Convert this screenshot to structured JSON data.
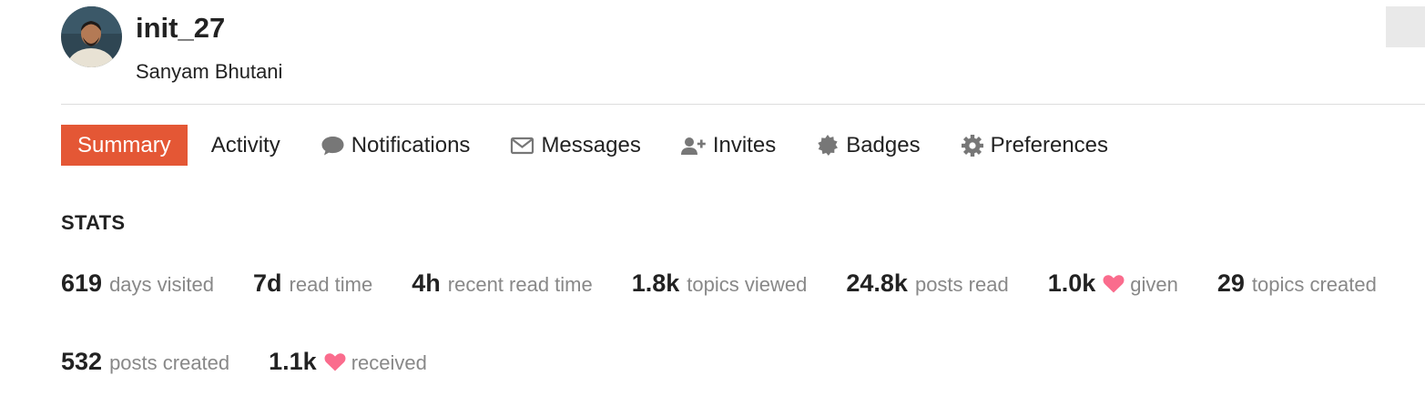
{
  "profile": {
    "username": "init_27",
    "full_name": "Sanyam Bhutani",
    "avatar_alt": "avatar"
  },
  "nav": {
    "items": [
      {
        "label": "Summary",
        "icon": "",
        "active": true
      },
      {
        "label": "Activity",
        "icon": ""
      },
      {
        "label": "Notifications",
        "icon": "comment-icon"
      },
      {
        "label": "Messages",
        "icon": "envelope-icon"
      },
      {
        "label": "Invites",
        "icon": "user-plus-icon"
      },
      {
        "label": "Badges",
        "icon": "certificate-icon"
      },
      {
        "label": "Preferences",
        "icon": "gear-icon"
      }
    ],
    "active_color": "#e45735"
  },
  "stats": {
    "heading": "STATS",
    "items": [
      {
        "value": "619",
        "label": "days visited"
      },
      {
        "value": "7d",
        "label": "read time"
      },
      {
        "value": "4h",
        "label": "recent read time"
      },
      {
        "value": "1.8k",
        "label": "topics viewed"
      },
      {
        "value": "24.8k",
        "label": "posts read"
      },
      {
        "value": "1.0k",
        "label": "given",
        "icon": "heart-icon"
      },
      {
        "value": "29",
        "label": "topics created"
      },
      {
        "value": "532",
        "label": "posts created"
      },
      {
        "value": "1.1k",
        "label": "received",
        "icon": "heart-icon"
      }
    ],
    "heart_color": "#fa6c8d"
  }
}
